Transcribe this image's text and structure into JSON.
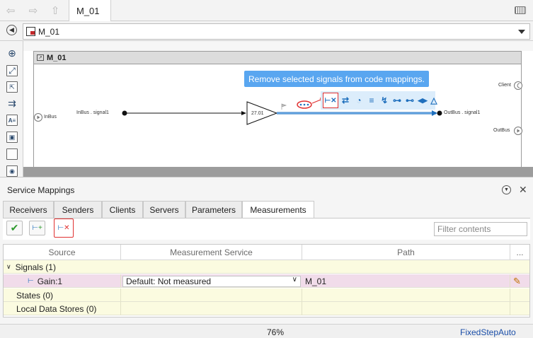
{
  "window": {
    "tab_title": "M_01",
    "address": "M_01"
  },
  "diagram": {
    "title": "M_01",
    "inport_label": "InBus",
    "signal_in_label": "InBus . signal1",
    "gain_value": "27.01",
    "signal_out_label": "OutBus . signal1",
    "client_label": "Client",
    "outport_label": "OutBus",
    "tooltip": "Remove selected signals from code mappings."
  },
  "panel": {
    "title": "Service Mappings",
    "tabs": [
      "Receivers",
      "Senders",
      "Clients",
      "Servers",
      "Parameters",
      "Measurements"
    ],
    "active_tab": "Measurements",
    "filter_placeholder": "Filter contents",
    "columns": [
      "Source",
      "Measurement Service",
      "Path",
      "..."
    ],
    "groups": {
      "signals": "Signals (1)",
      "states": "States (0)",
      "local_data_stores": "Local Data Stores (0)"
    },
    "signal_row": {
      "source": "Gain:1",
      "measurement_service": "Default: Not measured",
      "path": "M_01"
    }
  },
  "status": {
    "zoom": "76%",
    "solver": "FixedStepAuto"
  },
  "colors": {
    "tooltip_bg": "#59a6f0",
    "highlight_red": "#e03131",
    "signal_blue": "#1f6fbd",
    "row_yellow": "#fbfbe0",
    "row_pink": "#f1dcea"
  }
}
